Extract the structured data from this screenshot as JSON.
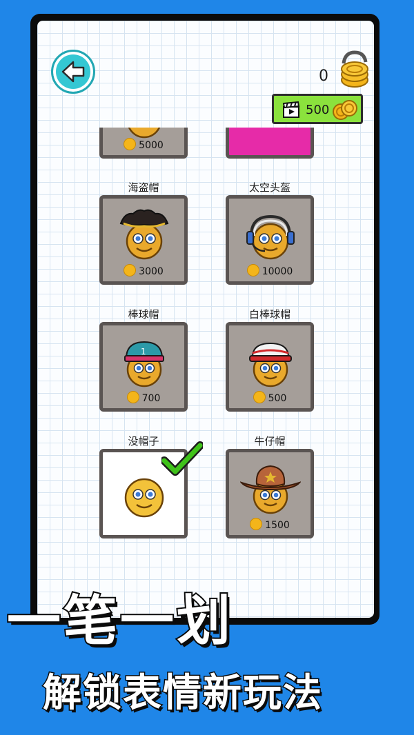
{
  "header": {
    "back_icon": "arrow-left-icon",
    "coin_balance": "0",
    "video_reward": "500"
  },
  "items": [
    {
      "label": "",
      "price": "5000",
      "hat": "partial",
      "partial": true
    },
    {
      "label": "",
      "price": "",
      "hat": "pink",
      "partial": true
    },
    {
      "label": "海盗帽",
      "price": "3000",
      "hat": "pirate"
    },
    {
      "label": "太空头盔",
      "price": "10000",
      "hat": "space"
    },
    {
      "label": "棒球帽",
      "price": "700",
      "hat": "baseball"
    },
    {
      "label": "白棒球帽",
      "price": "500",
      "hat": "white-baseball"
    },
    {
      "label": "没帽子",
      "price": "",
      "hat": "none",
      "selected": true
    },
    {
      "label": "牛仔帽",
      "price": "1500",
      "hat": "cowboy"
    }
  ],
  "promo": {
    "line1": "一笔一划",
    "line2": "解锁表情新玩法"
  },
  "colors": {
    "background": "#1f86e8",
    "accent_teal": "#34c7d3",
    "video_green": "#8be23d",
    "card_gray": "#a59e99",
    "check_green": "#3fc21a"
  }
}
